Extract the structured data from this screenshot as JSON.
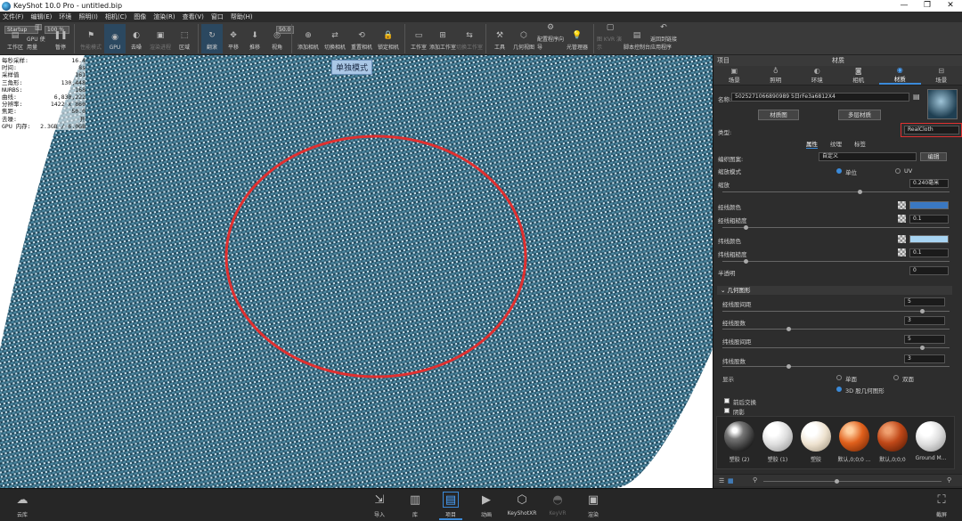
{
  "window": {
    "title": "KeyShot 10.0 Pro  -  untitled.bip",
    "controls": [
      "—",
      "❐",
      "✕"
    ]
  },
  "menu": [
    "文件(F)",
    "编辑(E)",
    "环境",
    "照明(I)",
    "相机(C)",
    "图像",
    "渲染(R)",
    "查看(V)",
    "窗口",
    "帮助(H)"
  ],
  "toolbar": {
    "startup_value": "Startup",
    "percent_value": "100 %",
    "fov_value": "50.0",
    "buttons": [
      {
        "label": "工作区",
        "icon": "workspace-icon"
      },
      {
        "label": "GPU 使用量",
        "icon": "gpu-usage-icon"
      },
      {
        "label": "暂停",
        "icon": "pause-icon"
      },
      {
        "label": "性能模式",
        "icon": "performance-icon",
        "dim": true
      },
      {
        "label": "GPU",
        "icon": "gpu-icon",
        "active": true
      },
      {
        "label": "去噪",
        "icon": "denoise-icon"
      },
      {
        "label": "渲染进程",
        "icon": "render-process-icon",
        "dim": true
      },
      {
        "label": "区域",
        "icon": "region-icon"
      },
      {
        "label": "翻滚",
        "icon": "tumble-icon",
        "active": true
      },
      {
        "label": "平移",
        "icon": "pan-icon"
      },
      {
        "label": "推移",
        "icon": "dolly-icon"
      },
      {
        "label": "视角",
        "icon": "fov-icon"
      },
      {
        "label": "添加相机",
        "icon": "add-camera-icon"
      },
      {
        "label": "切换相机",
        "icon": "switch-camera-icon"
      },
      {
        "label": "重置相机",
        "icon": "reset-camera-icon"
      },
      {
        "label": "锁定相机",
        "icon": "lock-camera-icon"
      },
      {
        "label": "工作室",
        "icon": "studio-icon"
      },
      {
        "label": "添加工作室",
        "icon": "add-studio-icon"
      },
      {
        "label": "切换工作室",
        "icon": "switch-studio-icon",
        "dim": true
      },
      {
        "label": "工具",
        "icon": "tools-icon"
      },
      {
        "label": "几何视图",
        "icon": "geometry-view-icon"
      },
      {
        "label": "配置程序向导",
        "icon": "configurator-icon"
      },
      {
        "label": "光管理器",
        "icon": "light-manager-icon"
      },
      {
        "label": "图 KVR 演示",
        "icon": "kvr-icon",
        "dim": true
      },
      {
        "label": "脚本控制台",
        "icon": "script-console-icon"
      },
      {
        "label": "返回到链接应用程序",
        "icon": "return-link-icon"
      }
    ]
  },
  "viewport": {
    "mode_label": "单独模式",
    "stats": [
      {
        "k": "每秒采样:",
        "v": "16.4"
      },
      {
        "k": "时间:",
        "v": "8s"
      },
      {
        "k": "采样值",
        "v": "161"
      },
      {
        "k": "三角形:",
        "v": "130,448"
      },
      {
        "k": "NURBS:",
        "v": "168"
      },
      {
        "k": "曲线:",
        "v": "6,830,222"
      },
      {
        "k": "分辨率:",
        "v": "1422 x 860"
      },
      {
        "k": "焦距:",
        "v": "50.0"
      },
      {
        "k": "去噪:",
        "v": "开"
      },
      {
        "k": "GPU 内存:",
        "v": "2.3GB / 6.0GB"
      }
    ]
  },
  "panel": {
    "header_left": "项目",
    "header_title": "材质",
    "tabs": [
      {
        "label": "场景",
        "icon": "scene-icon"
      },
      {
        "label": "照明",
        "icon": "lighting-icon"
      },
      {
        "label": "环境",
        "icon": "environment-icon"
      },
      {
        "label": "相机",
        "icon": "camera-icon"
      },
      {
        "label": "材质",
        "icon": "material-icon",
        "active": true
      },
      {
        "label": "场景",
        "icon": "scene-tree-icon"
      }
    ],
    "name_label": "名称:",
    "name_value": "5025271066890989 5日rFe3a6812X4",
    "graph_button": "材质图",
    "multi_button": "多层材质",
    "type_label": "类型:",
    "type_value": "RealCloth",
    "subtabs": [
      "属性",
      "纹理",
      "标签"
    ],
    "rows": {
      "pattern_label": "编织图案:",
      "pattern_value": "自定义",
      "pattern_edit": "编辑",
      "scale_mode_label": "缩放模式",
      "scale_mode_unit": "单位",
      "scale_mode_uv": "UV",
      "scale_label": "缩放",
      "scale_value": "0.240毫米",
      "warp_color_label": "经线颜色",
      "warp_rough_label": "经线粗糙度",
      "warp_rough_value": "0.1",
      "weft_color_label": "纬线颜色",
      "weft_rough_label": "纬线粗糙度",
      "weft_rough_value": "0.1",
      "transp_label": "半透明",
      "transp_value": "0",
      "geo_section": "几何图形",
      "warp_spacing_label": "经线股间距",
      "warp_spacing_value": "5",
      "warp_count_label": "经线股数",
      "warp_count_value": "3",
      "weft_spacing_label": "纬线股间距",
      "weft_spacing_value": "5",
      "weft_count_label": "纬线股数",
      "weft_count_value": "3",
      "display_label": "显示",
      "display_single": "单面",
      "display_double": "双面",
      "display_3d": "3D 股几何图形",
      "cb_backface": "前后交换",
      "cb_2": "阴影"
    },
    "colors": {
      "warp": "#3a78c2",
      "weft": "#a8d4f2"
    },
    "thumbs": [
      {
        "label": "塑胶 (2)",
        "color": "dark-gray"
      },
      {
        "label": "塑胶 (1)",
        "color": "white"
      },
      {
        "label": "塑胶",
        "color": "ivory"
      },
      {
        "label": "默认,0;0;0 ...",
        "color": "orange"
      },
      {
        "label": "默认,0;0;0",
        "color": "rust"
      },
      {
        "label": "Ground M...",
        "color": "white"
      }
    ]
  },
  "bottombar": {
    "left": {
      "label": "云库",
      "icon": "cloud-library-icon"
    },
    "items": [
      {
        "label": "导入",
        "icon": "import-icon"
      },
      {
        "label": "库",
        "icon": "library-icon"
      },
      {
        "label": "项目",
        "icon": "project-icon",
        "active": true
      },
      {
        "label": "动画",
        "icon": "animation-icon"
      },
      {
        "label": "KeyShotXR",
        "icon": "keyshotxr-icon"
      },
      {
        "label": "KeyVR",
        "icon": "keyvr-icon",
        "dim": true
      },
      {
        "label": "渲染",
        "icon": "render-icon"
      }
    ],
    "right": {
      "label": "截屏",
      "icon": "screenshot-icon"
    }
  }
}
